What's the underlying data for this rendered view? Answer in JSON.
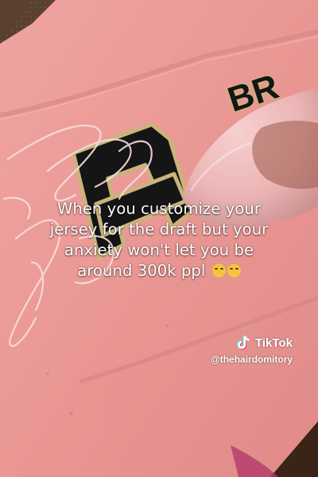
{
  "caption": {
    "line1": "When you customize your",
    "line2": "jersey for the draft but your",
    "line3": "anxiety won't let you be",
    "line4": "around 300k ppl",
    "emoji": "weary-face-emoji"
  },
  "watermark": {
    "logo_text": "TikTok",
    "handle": "@thehairdomitory",
    "icon": "tiktok-logo-icon"
  },
  "jersey": {
    "nameplate_text": "BR",
    "colors": {
      "fabric": "#ec9a98",
      "numeral": "#151515",
      "trim": "#c9b47a"
    }
  }
}
